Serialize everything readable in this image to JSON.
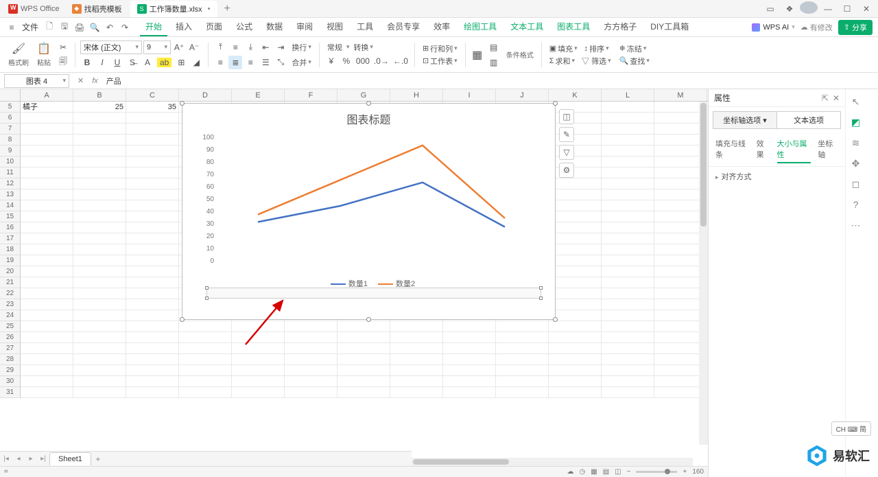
{
  "app": {
    "name": "WPS Office"
  },
  "tabs": [
    {
      "label": "找稻壳模板",
      "ic": "orange"
    },
    {
      "label": "工作簿数量.xlsx",
      "ic": "green",
      "dirty": "•",
      "active": true
    }
  ],
  "menu": {
    "file": "文件",
    "items": [
      "开始",
      "插入",
      "页面",
      "公式",
      "数据",
      "审阅",
      "视图",
      "工具",
      "会员专享",
      "效率"
    ],
    "ctx": [
      "绘图工具",
      "文本工具",
      "图表工具",
      "方方格子",
      "DIY工具箱"
    ],
    "active": "开始",
    "ai": "WPS AI",
    "changes": "有修改",
    "share": "分享"
  },
  "ribbon": {
    "font": "宋体 (正文)",
    "size": "9",
    "fmt_copy": "格式刷",
    "paste": "粘贴",
    "general": "常规",
    "convert": "转换",
    "rowcol": "行和列",
    "worksheet": "工作表",
    "cond": "条件格式",
    "fill": "填充",
    "sort": "排序",
    "freeze": "冻结",
    "sum": "求和",
    "find": "查找"
  },
  "namebox": "图表 4",
  "formula_bar": "产品",
  "cols": [
    "A",
    "B",
    "C",
    "D",
    "E",
    "F",
    "G",
    "H",
    "I",
    "J",
    "K",
    "L",
    "M"
  ],
  "rows_start": 5,
  "rows_end": 31,
  "cells": {
    "A5": "橘子",
    "B5": "25",
    "C5": "35"
  },
  "chart_data": {
    "type": "line",
    "title": "图表标题",
    "categories": [
      "",
      "",
      "",
      "",
      ""
    ],
    "series": [
      {
        "name": "数量1",
        "color": "#4472C4",
        "values": [
          32,
          45,
          64,
          28
        ]
      },
      {
        "name": "数量2",
        "color": "#ED7D31",
        "values": [
          38,
          66,
          94,
          35
        ]
      }
    ],
    "ylim": [
      0,
      100
    ],
    "yticks": [
      0,
      10,
      20,
      30,
      40,
      50,
      60,
      70,
      80,
      90,
      100
    ]
  },
  "sidebar": {
    "title": "属性",
    "selector": [
      "坐标轴选项",
      "文本选项"
    ],
    "tabs": [
      "填充与线条",
      "效果",
      "大小与属性",
      "坐标轴"
    ],
    "active_tab": "大小与属性",
    "items": [
      "对齐方式"
    ]
  },
  "sheet_tabs": {
    "name": "Sheet1"
  },
  "status": {
    "zoom": "160",
    "ime": "CH ⌨ 简"
  },
  "brand": "易软汇"
}
